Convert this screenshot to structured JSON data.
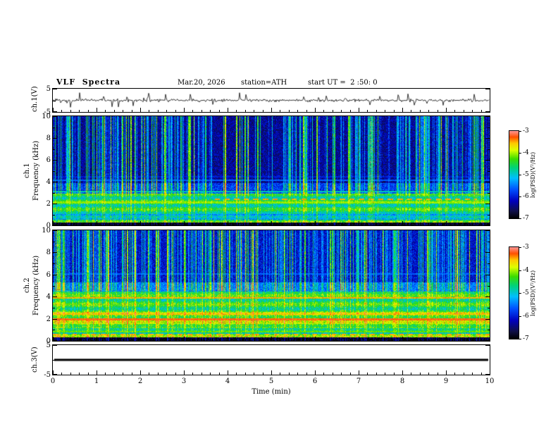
{
  "header": {
    "title": "VLF  Spectra",
    "date": "Mar.20, 2026",
    "station": "station=ATH",
    "start_ut": "start UT =  2 :50: 0"
  },
  "xaxis": {
    "label": "Time (min)",
    "lim": [
      0,
      10
    ],
    "tick_labels": [
      "0",
      "1",
      "2",
      "3",
      "4",
      "5",
      "6",
      "7",
      "8",
      "9",
      "10"
    ]
  },
  "colormap": {
    "stops": [
      {
        "pos": 0.0,
        "rgb": [
          0,
          0,
          0
        ]
      },
      {
        "pos": 0.08,
        "rgb": [
          15,
          15,
          70
        ]
      },
      {
        "pos": 0.2,
        "rgb": [
          0,
          0,
          190
        ]
      },
      {
        "pos": 0.33,
        "rgb": [
          0,
          80,
          255
        ]
      },
      {
        "pos": 0.46,
        "rgb": [
          0,
          190,
          255
        ]
      },
      {
        "pos": 0.58,
        "rgb": [
          0,
          210,
          120
        ]
      },
      {
        "pos": 0.68,
        "rgb": [
          60,
          220,
          0
        ]
      },
      {
        "pos": 0.78,
        "rgb": [
          220,
          255,
          0
        ]
      },
      {
        "pos": 0.86,
        "rgb": [
          255,
          200,
          0
        ]
      },
      {
        "pos": 0.93,
        "rgb": [
          255,
          80,
          0
        ]
      },
      {
        "pos": 1.0,
        "rgb": [
          255,
          150,
          150
        ]
      }
    ]
  },
  "chart_data": [
    {
      "type": "line",
      "panel": "ch1-waveform",
      "ylabel": "ch.1(V)",
      "ylim": [
        -5,
        5
      ],
      "ytick_values": [
        5,
        -5
      ],
      "ytick_labels": [
        "5",
        "-5"
      ],
      "signal": {
        "baseline_V": 0,
        "noise_amp_V": 0.8,
        "spike_count": 30,
        "spike_amp_V": 3.2,
        "flat": false
      },
      "description": "noisy black trace around 0 V with impulsive sferic spikes up to about +/-3 V"
    },
    {
      "type": "heatmap",
      "panel": "ch1-spectrogram",
      "ylabel_lines": [
        "ch.1",
        "Frequency (kHz)"
      ],
      "ylim": [
        0,
        10
      ],
      "ytick_values": [
        0,
        2,
        4,
        6,
        8,
        10
      ],
      "ytick_labels": [
        "0",
        "2",
        "4",
        "6",
        "8",
        "10"
      ],
      "colorbar": {
        "label": "log(PSD)(V²/Hz)",
        "lim": [
          -7,
          -3
        ],
        "tick_labels": [
          "-3",
          "-4",
          "-5",
          "-6",
          "-7"
        ]
      },
      "bands": [
        {
          "f": [
            0,
            0.25
          ],
          "psd": -7.0
        },
        {
          "f": [
            0.25,
            0.5
          ],
          "psd": -4.3
        },
        {
          "f": [
            0.5,
            1.05
          ],
          "psd": -5.3
        },
        {
          "f": [
            1.05,
            2.9
          ],
          "psd": -4.7
        },
        {
          "f": [
            2.9,
            3.9
          ],
          "psd": -5.8
        },
        {
          "f": [
            3.9,
            10.01
          ],
          "psd": -6.35
        }
      ],
      "banding": {
        "range": [
          0.4,
          3.2
        ],
        "amp": 0.3,
        "freq": 9.0,
        "phase": 1.0
      },
      "lines": [
        {
          "f": 2.1,
          "w": 0.14,
          "psd": -4.1
        },
        {
          "f": 3.08,
          "w": 0.12,
          "psd": -4.9
        },
        {
          "f": 3.55,
          "w": 0.14,
          "psd": -6.9
        },
        {
          "f": 4.15,
          "w": 0.12,
          "psd": -5.6
        },
        {
          "f": 4.45,
          "w": 0.1,
          "psd": -6.0
        },
        {
          "f": 2.38,
          "w": 0.12,
          "psd": -3.5,
          "t_range": [
            3.7,
            9.7
          ],
          "dash": [
            0.12,
            0.1
          ]
        },
        {
          "f": 0.32,
          "w": 0.1,
          "psd": -3.8,
          "t_range": [
            4.5,
            9.7
          ],
          "dash": [
            0.06,
            0.14
          ]
        }
      ],
      "streaks": {
        "density": 0.42,
        "min_boost": 0.5,
        "max_extra": 1.9,
        "f_full": 2.9,
        "partial": 0.3
      },
      "noise": 0.8,
      "description": "0-3 kHz green/cyan hiss band, dark blue above 4 kHz crossed by dense vertical sferic streaks"
    },
    {
      "type": "heatmap",
      "panel": "ch2-spectrogram",
      "ylabel_lines": [
        "ch.2",
        "Frequency (kHz)"
      ],
      "ylim": [
        0,
        10
      ],
      "ytick_values": [
        0,
        2,
        4,
        6,
        8,
        10
      ],
      "ytick_labels": [
        "0",
        "2",
        "4",
        "6",
        "8",
        "10"
      ],
      "colorbar": {
        "label": "log(PSD)(V²/Hz)",
        "lim": [
          -7,
          -3
        ],
        "tick_labels": [
          "-3",
          "-4",
          "-5",
          "-6",
          "-7"
        ]
      },
      "bands": [
        {
          "f": [
            0,
            0.35
          ],
          "psd": -7.0
        },
        {
          "f": [
            0.35,
            0.62
          ],
          "psd": -4.1
        },
        {
          "f": [
            0.62,
            1.15
          ],
          "psd": -5.0
        },
        {
          "f": [
            1.15,
            2.6
          ],
          "psd": -4.25
        },
        {
          "f": [
            2.6,
            4.45
          ],
          "psd": -4.6
        },
        {
          "f": [
            4.45,
            5.3
          ],
          "psd": -5.5
        },
        {
          "f": [
            5.3,
            10.01
          ],
          "psd": -6.1
        }
      ],
      "banding": {
        "range": [
          0.5,
          4.4
        ],
        "amp": 0.3,
        "freq": 8.0,
        "phase": 0.3
      },
      "lines": [
        {
          "f": 1.95,
          "w": 0.18,
          "psd": -3.3
        },
        {
          "f": 2.4,
          "w": 0.14,
          "psd": -3.6
        },
        {
          "f": 1.55,
          "w": 0.1,
          "psd": -4.0
        },
        {
          "f": 3.9,
          "w": 0.16,
          "psd": -3.5
        },
        {
          "f": 4.2,
          "w": 0.1,
          "psd": -5.9
        },
        {
          "f": 0.55,
          "w": 0.12,
          "psd": -3.5,
          "dash": [
            0.1,
            0.12
          ]
        },
        {
          "f": 0.82,
          "w": 0.08,
          "psd": -4.2
        },
        {
          "f": 6.05,
          "w": 0.1,
          "psd": -5.6
        }
      ],
      "streaks": {
        "density": 0.45,
        "min_boost": 0.5,
        "max_extra": 1.8,
        "f_full": 4.5,
        "partial": 0.35
      },
      "noise": 0.8,
      "description": "0-4.5 kHz yellow/green hiss with red power-line harmonics near 2 and 4 kHz, blue above with vertical sferic streaks"
    },
    {
      "type": "line",
      "panel": "ch3-waveform",
      "ylabel": "ch.3(V)",
      "ylim": [
        -5,
        5
      ],
      "ytick_values": [
        5,
        -5
      ],
      "ytick_labels": [
        "5",
        "-5"
      ],
      "signal": {
        "baseline_V": 0,
        "flat": true,
        "thickness_px": 3
      },
      "description": "flat thick black line at 0 V (channel off/saturated)"
    }
  ]
}
